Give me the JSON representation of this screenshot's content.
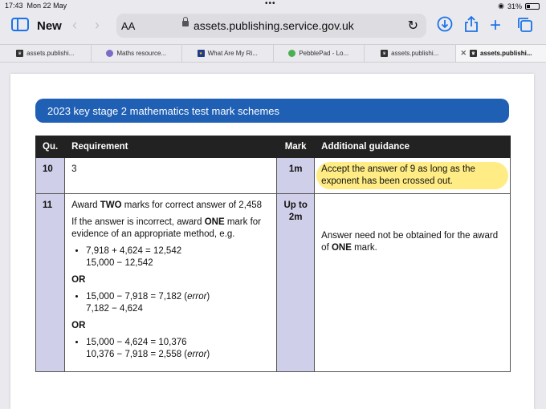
{
  "status_bar": {
    "time": "17:43",
    "date": "Mon 22 May",
    "battery": "31%",
    "battery_level": 0.31
  },
  "toolbar": {
    "new_label": "New",
    "text_size_label": "AA",
    "url": "assets.publishing.service.gov.uk"
  },
  "tabs": [
    {
      "label": "assets.publishi...",
      "icon": "gov-crest-icon"
    },
    {
      "label": "Maths resource...",
      "icon": "maths-icon"
    },
    {
      "label": "What Are My Ri...",
      "icon": "star-icon"
    },
    {
      "label": "PebblePad - Lo...",
      "icon": "pebblepad-icon"
    },
    {
      "label": "assets.publishi...",
      "icon": "gov-crest-icon"
    },
    {
      "label": "assets.publishi...",
      "icon": "gov-crest-icon",
      "active": true
    }
  ],
  "document": {
    "banner": "2023 key stage 2 mathematics test mark schemes",
    "headers": {
      "qu": "Qu.",
      "requirement": "Requirement",
      "mark": "Mark",
      "guidance": "Additional guidance"
    },
    "rows": [
      {
        "qu": "10",
        "requirement": "3",
        "mark": "1m",
        "guidance": "Accept the answer of 9 as long as the exponent has been crossed out."
      },
      {
        "qu": "11",
        "req_p1_a": "Award ",
        "req_p1_b": "TWO",
        "req_p1_c": " marks for correct answer of 2,458",
        "req_p2_a": "If the answer is incorrect, award ",
        "req_p2_b": "ONE",
        "req_p2_c": " mark for evidence of an appropriate method, e.g.",
        "m1_l1": "7,918 + 4,624 = 12,542",
        "m1_l2": "15,000 − 12,542",
        "or1": "OR",
        "m2_l1a": "15,000 − 7,918 = 7,182 (",
        "m2_l1b": "error",
        "m2_l1c": ")",
        "m2_l2": "7,182 − 4,624",
        "or2": "OR",
        "m3_l1": "15,000 − 4,624 = 10,376",
        "m3_l2a": "10,376 − 7,918 = 2,558 (",
        "m3_l2b": "error",
        "m3_l2c": ")",
        "mark": "Up to 2m",
        "guidance_a": "Answer need not be obtained for the award of ",
        "guidance_b": "ONE",
        "guidance_c": " mark."
      }
    ]
  },
  "colors": {
    "banner": "#1f5fb4",
    "accent": "#1a73e8",
    "mark_column": "#d0cfe9",
    "highlight": "#ffe450"
  }
}
